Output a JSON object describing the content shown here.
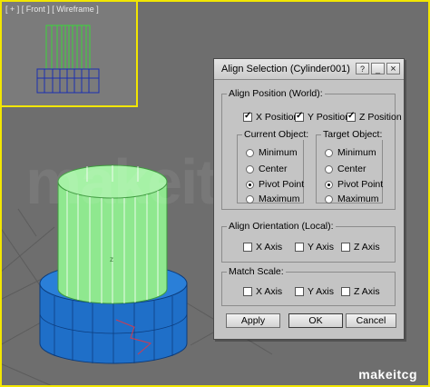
{
  "front_viewport": {
    "label": "[ + ] [ Front ] [ Wireframe ]"
  },
  "watermark": "makeitcg",
  "brand": "makeitcg",
  "dialog": {
    "title": "Align Selection (Cylinder001)",
    "titlebar_buttons": [
      "?",
      "_",
      "×"
    ],
    "align_position": {
      "label": "Align Position (World):",
      "x": {
        "label": "X Position",
        "checked": true
      },
      "y": {
        "label": "Y Position",
        "checked": true
      },
      "z": {
        "label": "Z Position",
        "checked": true
      },
      "current_object": {
        "label": "Current Object:",
        "options": [
          "Minimum",
          "Center",
          "Pivot Point",
          "Maximum"
        ],
        "selected": "Pivot Point"
      },
      "target_object": {
        "label": "Target Object:",
        "options": [
          "Minimum",
          "Center",
          "Pivot Point",
          "Maximum"
        ],
        "selected": "Pivot Point"
      }
    },
    "align_orientation": {
      "label": "Align Orientation (Local):",
      "x": {
        "label": "X Axis",
        "checked": false
      },
      "y": {
        "label": "Y Axis",
        "checked": false
      },
      "z": {
        "label": "Z Axis",
        "checked": false
      }
    },
    "match_scale": {
      "label": "Match Scale:",
      "x": {
        "label": "X Axis",
        "checked": false
      },
      "y": {
        "label": "Y Axis",
        "checked": false
      },
      "z": {
        "label": "Z Axis",
        "checked": false
      }
    },
    "buttons": {
      "apply": "Apply",
      "ok": "OK",
      "cancel": "Cancel"
    }
  },
  "colors": {
    "viewport_border": "#f2e600",
    "cylinder_green": "#8fe88f",
    "cylinder_blue": "#1f6fc8",
    "dialog_bg": "#c4c4c4"
  }
}
